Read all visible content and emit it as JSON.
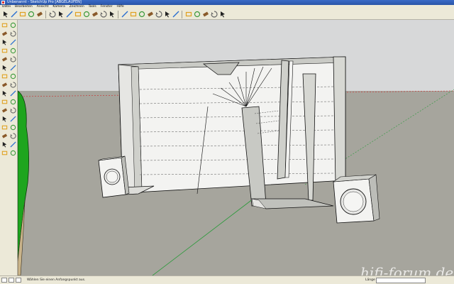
{
  "window": {
    "title": "Unbenannt - SketchUp Pro [ABGELAUFEN]"
  },
  "menu": [
    "Datei",
    "Bearbeiten",
    "Ansicht",
    "Kamera",
    "Zeichnen",
    "Tools",
    "Fenster",
    "Hilfe"
  ],
  "toolbar_icons": [
    "select-icon",
    "pencil-icon",
    "line-icon",
    "rectangle-icon",
    "circle-icon",
    "eraser-icon",
    "rotate-icon",
    "paint-icon",
    "pushpull-icon",
    "followme-icon",
    "move-icon",
    "offset-icon",
    "tape-icon",
    "orbit-icon",
    "pan-icon",
    "zoom-icon",
    "zoom-window-icon",
    "zoom-extents-icon",
    "previous-icon",
    "next-icon",
    "walk-icon",
    "position-camera-icon",
    "look-around-icon",
    "section-icon",
    "layers-icon"
  ],
  "left_tools": [
    "select-icon",
    "component-icon",
    "paint-icon",
    "eraser-icon",
    "rectangle-icon",
    "line-icon",
    "circle-icon",
    "arc-icon",
    "polygon-icon",
    "freehand-icon",
    "move-icon",
    "pushpull-icon",
    "rotate-icon",
    "followme-icon",
    "scale-icon",
    "offset-icon",
    "tape-icon",
    "dimension-icon",
    "protractor-icon",
    "text-icon",
    "axes-icon",
    "3dtext-icon",
    "orbit-icon",
    "pan-icon",
    "zoom-icon",
    "zoom-window-icon",
    "previous-icon",
    "zoom-extents-icon",
    "position-camera-icon",
    "walk-icon",
    "look-around-icon",
    "section-icon"
  ],
  "colors": {
    "sky": "#d6d7d8",
    "ground": "#a6a59d",
    "panel_light": "#f3f3f1",
    "panel_shade": "#c8c9c4",
    "axis_red": "#cc2a2a",
    "axis_green": "#2a9a3a",
    "figure_green": "#18a018"
  },
  "status": {
    "hint": "Wählen Sie einen Anfangspunkt aus.",
    "measure_label": "Länge"
  },
  "watermark": "hifi-forum.de"
}
